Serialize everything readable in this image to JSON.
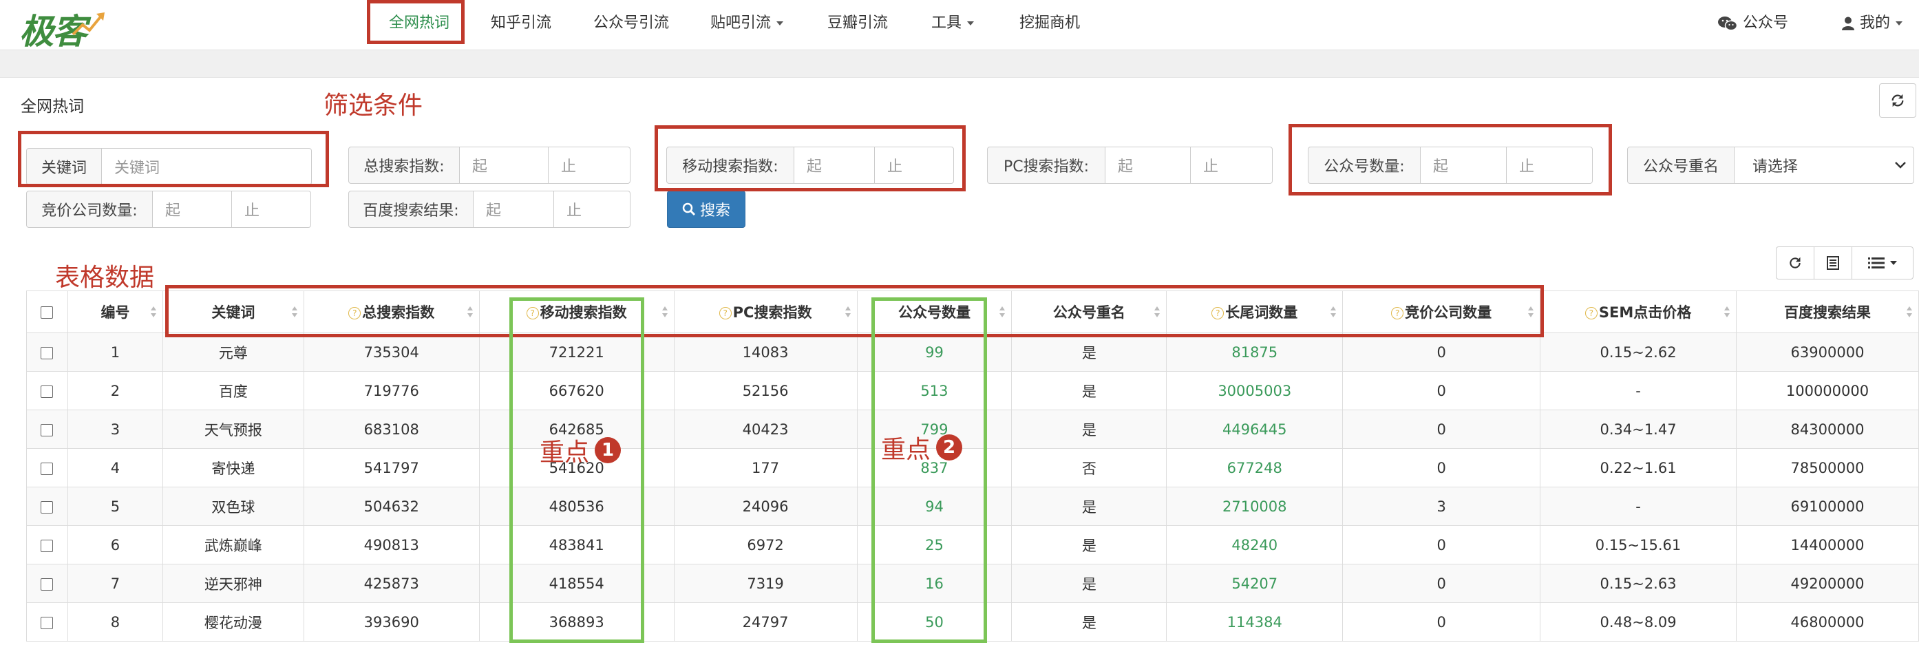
{
  "brand": {
    "logo_text": "极客"
  },
  "nav": {
    "items": [
      {
        "label": "全网热词",
        "active": true
      },
      {
        "label": "知乎引流"
      },
      {
        "label": "公众号引流"
      },
      {
        "label": "贴吧引流",
        "dropdown": true
      },
      {
        "label": "豆瓣引流"
      },
      {
        "label": "工具",
        "dropdown": true
      },
      {
        "label": "挖掘商机"
      }
    ],
    "right": {
      "wechat_label": "公众号",
      "user_label": "我的"
    }
  },
  "panel": {
    "title": "全网热词"
  },
  "filters": {
    "keyword": {
      "label": "关键词",
      "placeholder": "关键词"
    },
    "total_index": {
      "label": "总搜索指数:",
      "from": "起",
      "to": "止"
    },
    "mobile_index": {
      "label": "移动搜索指数:",
      "from": "起",
      "to": "止"
    },
    "pc_index": {
      "label": "PC搜索指数:",
      "from": "起",
      "to": "止"
    },
    "wechat_count": {
      "label": "公众号数量:",
      "from": "起",
      "to": "止"
    },
    "wechat_dup": {
      "label": "公众号重名",
      "value": "请选择"
    },
    "bid_count": {
      "label": "竞价公司数量:",
      "from": "起",
      "to": "止"
    },
    "baidu_results": {
      "label": "百度搜索结果:",
      "from": "起",
      "to": "止"
    },
    "search_button": "搜索"
  },
  "annotations": {
    "filter_label": "筛选条件",
    "table_label": "表格数据",
    "key1": {
      "text": "重点",
      "num": "1"
    },
    "key2": {
      "text": "重点",
      "num": "2"
    }
  },
  "table": {
    "columns": [
      "编号",
      "关键词",
      "总搜索指数",
      "移动搜索指数",
      "PC搜索指数",
      "公众号数量",
      "公众号重名",
      "长尾词数量",
      "竞价公司数量",
      "SEM点击价格",
      "百度搜索结果"
    ],
    "rows": [
      [
        "1",
        "元尊",
        "735304",
        "721221",
        "14083",
        "99",
        "是",
        "81875",
        "0",
        "0.15~2.62",
        "63900000"
      ],
      [
        "2",
        "百度",
        "719776",
        "667620",
        "52156",
        "513",
        "是",
        "30005003",
        "0",
        "-",
        "100000000"
      ],
      [
        "3",
        "天气预报",
        "683108",
        "642685",
        "40423",
        "799",
        "是",
        "4496445",
        "0",
        "0.34~1.47",
        "84300000"
      ],
      [
        "4",
        "寄快递",
        "541797",
        "541620",
        "177",
        "837",
        "否",
        "677248",
        "0",
        "0.22~1.61",
        "78500000"
      ],
      [
        "5",
        "双色球",
        "504632",
        "480536",
        "24096",
        "94",
        "是",
        "2710008",
        "3",
        "-",
        "69100000"
      ],
      [
        "6",
        "武炼巅峰",
        "490813",
        "483841",
        "6972",
        "25",
        "是",
        "48240",
        "0",
        "0.15~15.61",
        "14400000"
      ],
      [
        "7",
        "逆天邪神",
        "425873",
        "418554",
        "7319",
        "16",
        "是",
        "54207",
        "0",
        "0.15~2.63",
        "49200000"
      ],
      [
        "8",
        "樱花动漫",
        "393690",
        "368893",
        "24797",
        "50",
        "是",
        "114384",
        "0",
        "0.48~8.09",
        "46800000"
      ]
    ]
  },
  "colors": {
    "annotation_red": "#c0392b",
    "annotation_green": "#7cc557",
    "link_green": "#3a9a5a",
    "primary_blue": "#337ab7"
  }
}
